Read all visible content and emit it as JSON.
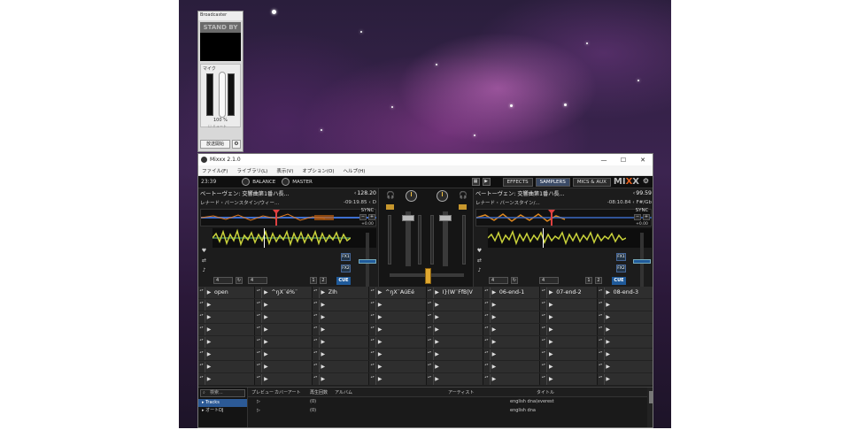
{
  "widget": {
    "title": "Broadcaster",
    "standby": "STAND BY",
    "mic_label": "マイク",
    "mic_percent": "100 %",
    "mic_check": "ミュート",
    "start_button": "放送開始"
  },
  "window": {
    "title": "Mixxx 2.1.0",
    "minimize": "—",
    "maximize": "☐",
    "close": "✕"
  },
  "menu": [
    "ファイル(F)",
    "ライブラリ(L)",
    "表示(V)",
    "オプション(O)",
    "ヘルプ(H)"
  ],
  "topbar": {
    "clock": "23:39",
    "balance": "BALANCE",
    "master": "MASTER",
    "effects": "EFFECTS",
    "samplers": "SAMPLERS",
    "mics": "MICS & AUX",
    "logo_a": "MI",
    "logo_x": "X",
    "logo_b": "X"
  },
  "deck_left": {
    "title": "ベートーヴェン: 交響曲第1番ハ長...",
    "bpm": "128.20",
    "artist": "レナード・バーンスタイン/ウィー...",
    "time": "-09:19.85",
    "key": "D",
    "loop_size": "4",
    "beat_size": "4",
    "hot1": "1",
    "hot2": "2",
    "hot3": "3",
    "hot4": "4",
    "fx1": "FX1",
    "fx2": "FX2",
    "cue": "CUE",
    "sync": "SYNC",
    "plus": "+",
    "minus": "−",
    "pitch_val": "+0.00"
  },
  "deck_right": {
    "title": "ベートーヴェン: 交響曲第1番ハ長...",
    "bpm": "99.59",
    "artist": "レナード・バーンスタイン/...",
    "time": "-08:10.84",
    "key": "F#/Gb",
    "loop_size": "4",
    "beat_size": "4",
    "hot1": "1",
    "hot2": "2",
    "hot3": "3",
    "hot4": "4",
    "fx1": "FX1",
    "fx2": "FX2",
    "cue": "CUE",
    "sync": "SYNC",
    "plus": "+",
    "minus": "−",
    "pitch_val": "+0.00"
  },
  "samplers": {
    "names": [
      "open",
      "^ŋX¨é%¨",
      "ZIh",
      "^ŋX¨ÀúEé",
      "I}(W¨FfB|V",
      "06-end-1",
      "07-end-2",
      "08-end-3"
    ]
  },
  "library": {
    "search_placeholder": "検索...",
    "tree": [
      "Tracks",
      "オートDJ"
    ],
    "columns": [
      "プレビュー",
      "カバーアート",
      "再生回数",
      "アルバム",
      "アーティスト",
      "タイトル"
    ],
    "rows": [
      {
        "plays": "(0)",
        "title": "english dna(everest"
      },
      {
        "plays": "(0)",
        "title": "english dna"
      }
    ]
  }
}
